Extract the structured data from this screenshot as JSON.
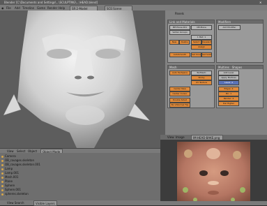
{
  "title": "Blender [C:\\Documents and Settings\\...\\SCULPTING\\...\\HEAD.blend]",
  "menu": [
    "File",
    "Add",
    "Timeline",
    "Game",
    "Render",
    "Help"
  ],
  "scene_field": "SR:2-Model",
  "scene_field2": "SCE:Scene",
  "buttons_header": "Panels",
  "panels": {
    "links": {
      "title": "Link and Materials",
      "me_field": "ME:Plane.001",
      "ob_field": "OB:Plane",
      "vertex_groups": "Vertex Groups",
      "material": "1 Mat: 1",
      "new": "New",
      "delete": "Delete",
      "select": "Select",
      "deselect": "Deselect",
      "assign": "Assign",
      "autosmooth": "AutoSmooth",
      "set_smooth": "Set Smooth",
      "set_solid": "Set Solid"
    },
    "modifiers": {
      "title": "Modifiers",
      "add": "Add Modifier"
    },
    "mesh": {
      "title": "Mesh",
      "auto_texspace": "Auto TexSpace",
      "texmesh": "TexMesh:",
      "sticky": "Sticky",
      "uv_texture": "UV Texture",
      "center_new": "Center New",
      "center_cursor": "Center Cursor",
      "double_sided": "Double Sided",
      "no_vnormal_flip": "No V.Normal Flip"
    },
    "multires": {
      "title": "Multires",
      "tab2": "Shapes",
      "add_level": "Add Level",
      "apply": "Apply Multires",
      "level": "Level: 4",
      "edges": "Edges: 4",
      "pin": "Pin: 1",
      "render": "Render: 4",
      "del_higher": "Del Higher"
    }
  },
  "viewport": {
    "mode": "Object Mode",
    "view": "View",
    "select": "Select",
    "object": "Object"
  },
  "outliner": {
    "items": [
      "Camera",
      "OB_ravages.skeleton",
      "OB_ravages.skeleton.001",
      "Lamp",
      "Lamp.001",
      "Mesh.001",
      "Plane",
      "Sphere",
      "Sphere.001",
      "spheres.skeleton"
    ],
    "footer": "View  Search",
    "display": "Visible Layers"
  },
  "image_editor": {
    "name": "IM:HEAD-BAKE.png",
    "menu": [
      "View",
      "Image"
    ]
  },
  "colors": {
    "accent": "#e08a3a",
    "panel": "#9a9a9a",
    "outliner_dot": "#d6a64a"
  }
}
